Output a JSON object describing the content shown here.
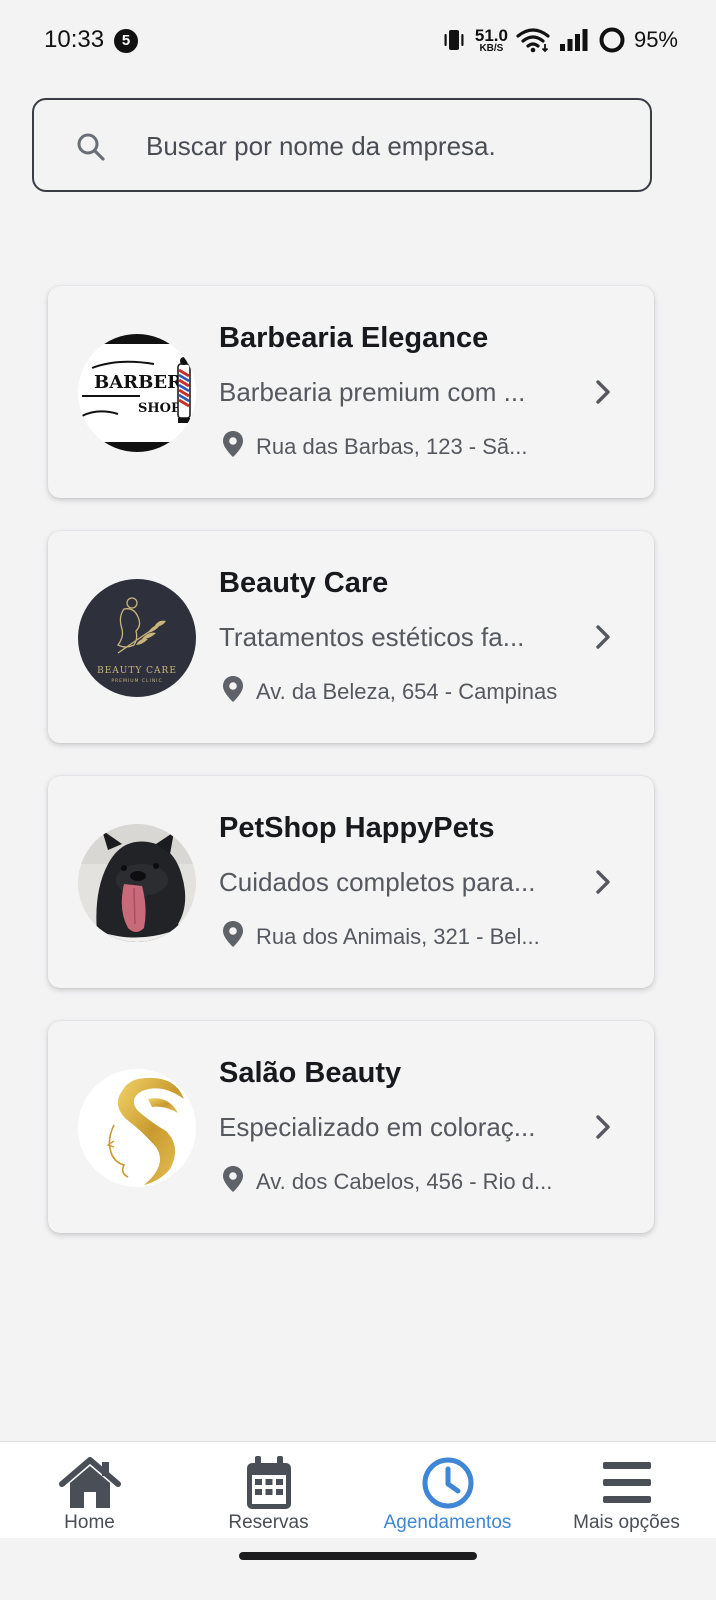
{
  "status_bar": {
    "time": "10:33",
    "notification_count": "5",
    "net_speed_value": "51.0",
    "net_speed_unit": "KB/S",
    "battery": "95%"
  },
  "search": {
    "placeholder": "Buscar por nome da empresa.",
    "value": ""
  },
  "businesses": [
    {
      "name": "Barbearia Elegance",
      "description": "Barbearia premium com ...",
      "address": "Rua das Barbas, 123 - Sã...",
      "logo": "barber-shop-logo",
      "logo_text": "BARBER SHOP"
    },
    {
      "name": "Beauty Care",
      "description": "Tratamentos estéticos fa...",
      "address": "Av. da Beleza, 654 - Campinas",
      "logo": "beauty-care-logo",
      "logo_text": "BEAUTY CARE"
    },
    {
      "name": "PetShop HappyPets",
      "description": "Cuidados completos para...",
      "address": "Rua dos Animais, 321 - Bel...",
      "logo": "dog-photo"
    },
    {
      "name": "Salão Beauty",
      "description": "Especializado em coloraç...",
      "address": "Av. dos Cabelos, 456 - Rio d...",
      "logo": "gold-hair-logo"
    }
  ],
  "bottom_nav": {
    "items": [
      {
        "label": "Home",
        "icon": "home-icon",
        "active": false
      },
      {
        "label": "Reservas",
        "icon": "calendar-icon",
        "active": false
      },
      {
        "label": "Agendamentos",
        "icon": "clock-icon",
        "active": true
      },
      {
        "label": "Mais opções",
        "icon": "menu-icon",
        "active": false
      }
    ]
  },
  "colors": {
    "background": "#f3f3f4",
    "active_nav": "#3f86d6",
    "inactive_nav": "#4a4e56",
    "text_primary": "#17191d",
    "text_secondary": "#55585e"
  }
}
